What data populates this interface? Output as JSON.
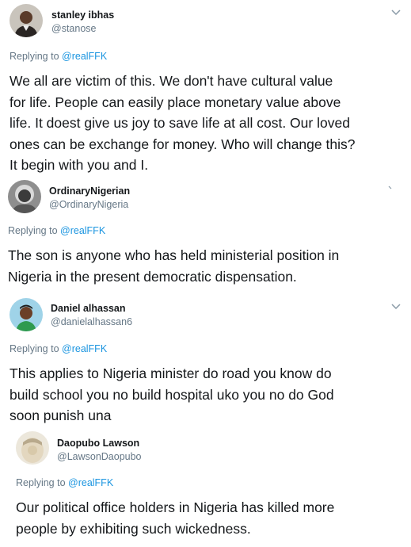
{
  "tweets": [
    {
      "name": "stanley ibhas",
      "handle": "@stanose",
      "replying_prefix": "Replying to ",
      "replying_to": "@realFFK",
      "body": "We all are victim of this. We don't have cultural value\nfor life. People can easily place monetary value above\nlife. It doest give us joy to save life at all cost. Our loved\nones can be exchange for money. Who will change this?\nIt begin with you and I."
    },
    {
      "name": "OrdinaryNigerian",
      "handle": "@OrdinaryNigeria",
      "replying_prefix": "Replying to ",
      "replying_to": "@realFFK",
      "body": "The son is anyone who has held ministerial position in\nNigeria in the present democratic dispensation."
    },
    {
      "name": "Daniel alhassan",
      "handle": "@danielalhassan6",
      "replying_prefix": "Replying to ",
      "replying_to": "@realFFK",
      "body": "This applies to Nigeria minister do road you know do\nbuild school you no build hospital uko you no do God\nsoon punish una"
    },
    {
      "name": "Daopubo Lawson",
      "handle": "@LawsonDaopubo",
      "replying_prefix": "Replying to ",
      "replying_to": "@realFFK",
      "body": "Our political office holders in Nigeria has killed more\npeople by exhibiting such wickedness."
    }
  ],
  "icons": {
    "more_menu": "chevron-down-icon",
    "avatar": "avatar"
  },
  "colors": {
    "name": "#14171a",
    "handle": "#657786",
    "mention": "#1b95e0",
    "chevron": "#8899a6"
  }
}
